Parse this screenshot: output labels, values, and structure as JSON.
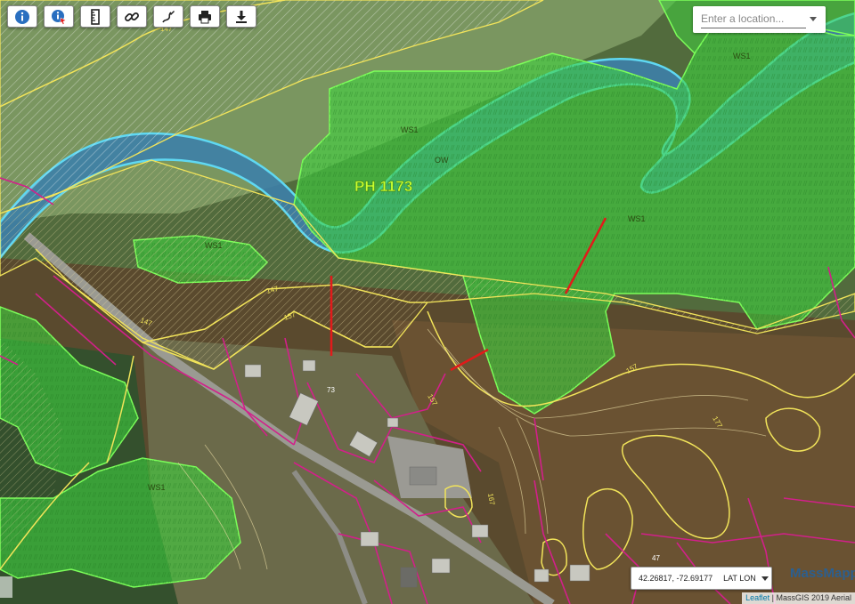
{
  "toolbar": {
    "buttons": [
      {
        "name": "info-button",
        "icon": "info-icon"
      },
      {
        "name": "identify-button",
        "icon": "info-cursor-icon"
      },
      {
        "name": "measure-button",
        "icon": "ruler-icon"
      },
      {
        "name": "link-button",
        "icon": "link-icon"
      },
      {
        "name": "draw-button",
        "icon": "pen-icon"
      },
      {
        "name": "print-button",
        "icon": "printer-icon"
      },
      {
        "name": "download-button",
        "icon": "download-icon"
      }
    ]
  },
  "search": {
    "placeholder": "Enter a location..."
  },
  "coordinates": {
    "value": "42.26817, -72.69177",
    "mode": "LAT LON"
  },
  "brand": "MassMapp",
  "attribution": {
    "leaflet": "Leaflet",
    "source": "MassGIS 2019 Aerial"
  },
  "map_labels": {
    "parcel_id": "PH 1173",
    "ws1_a": "WS1",
    "ws1_b": "WS1",
    "ws1_c": "WS1",
    "ws1_d": "WS1",
    "ws1_e": "WS1",
    "ow": "OW",
    "c147_a": "147",
    "c147_b": "147",
    "c147_c": "147",
    "c157_a": "157",
    "c157_b": "157",
    "c157_c": "157",
    "c177": "177",
    "c167": "167",
    "num_47": "47",
    "num_73": "73"
  },
  "colors": {
    "wetland_fill": "#3fd43f",
    "wetland_edge": "#7cff5a",
    "river": "#3d7fa8",
    "river_edge": "#5fd8f2",
    "contour": "#f2e45a",
    "parcel": "#d2208a",
    "redline": "#e21a1a",
    "label_green": "#c8ff30"
  }
}
